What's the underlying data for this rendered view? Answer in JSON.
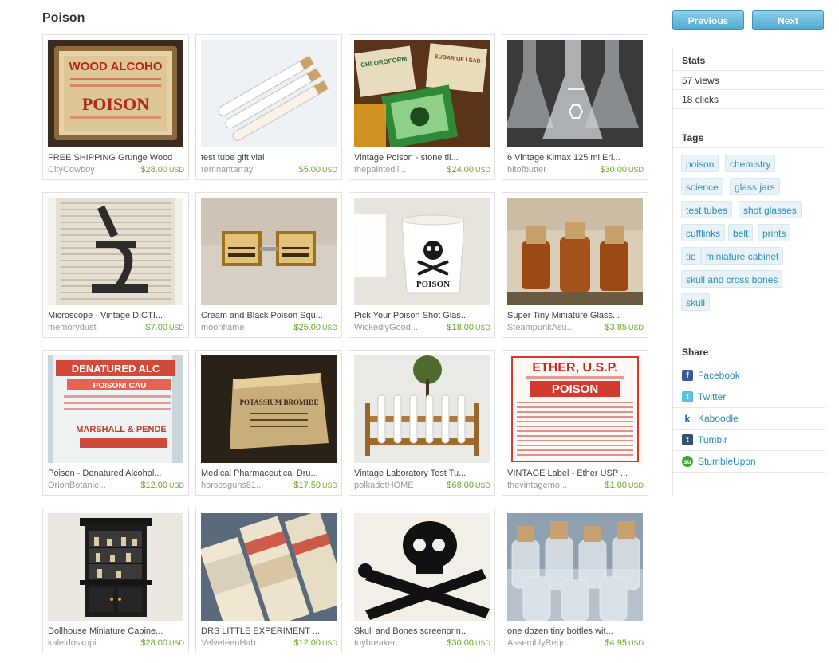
{
  "page": {
    "title": "Poison"
  },
  "nav": {
    "previous_label": "Previous",
    "next_label": "Next"
  },
  "items": [
    {
      "title": "FREE SHIPPING Grunge Wood",
      "shop": "CityCowboy",
      "price": "$28.00",
      "currency": "USD"
    },
    {
      "title": "test tube gift vial",
      "shop": "remnantarray",
      "price": "$5.00",
      "currency": "USD"
    },
    {
      "title": "Vintage Poison - stone til...",
      "shop": "thepaintedli...",
      "price": "$24.00",
      "currency": "USD"
    },
    {
      "title": "6 Vintage Kimax 125 ml Erl...",
      "shop": "bitofbutter",
      "price": "$30.00",
      "currency": "USD"
    },
    {
      "title": "Microscope - Vintage DICTI...",
      "shop": "memorydust",
      "price": "$7.00",
      "currency": "USD"
    },
    {
      "title": "Cream and Black Poison Squ...",
      "shop": "moonflame",
      "price": "$25.00",
      "currency": "USD"
    },
    {
      "title": "Pick Your Poison Shot Glas...",
      "shop": "WickedlyGood...",
      "price": "$18.00",
      "currency": "USD"
    },
    {
      "title": "Super Tiny Miniature Glass...",
      "shop": "SteampunkAsu...",
      "price": "$3.85",
      "currency": "USD"
    },
    {
      "title": "Poison - Denatured Alcohol...",
      "shop": "OrionBotanic...",
      "price": "$12.00",
      "currency": "USD"
    },
    {
      "title": "Medical Pharmaceutical Dru...",
      "shop": "horsesguns81...",
      "price": "$17.50",
      "currency": "USD"
    },
    {
      "title": "Vintage Laboratory Test Tu...",
      "shop": "polkadotHOME",
      "price": "$68.00",
      "currency": "USD"
    },
    {
      "title": "VINTAGE Label - Ether USP ...",
      "shop": "thevintagemo...",
      "price": "$1.00",
      "currency": "USD"
    },
    {
      "title": "Dollhouse Miniature Cabine...",
      "shop": "kaleidoskopi...",
      "price": "$28.00",
      "currency": "USD"
    },
    {
      "title": "DRS LITTLE EXPERIMENT ...",
      "shop": "VelveteenHab...",
      "price": "$12.00",
      "currency": "USD"
    },
    {
      "title": "Skull and Bones screenprin...",
      "shop": "toybreaker",
      "price": "$30.00",
      "currency": "USD"
    },
    {
      "title": "one dozen tiny bottles wit...",
      "shop": "AssemblyRequ...",
      "price": "$4.95",
      "currency": "USD"
    }
  ],
  "images": {
    "wood_label_text": "WOOD ALCOHO",
    "wood_label_poison": "POISON",
    "chloroform_label": "CHLOROFORM",
    "lead_label": "SUGAR OF LEAD",
    "shot_glass_text": "POISON",
    "denatured_label": "DENATURED ALC",
    "denatured_poison": "POISON! CAU",
    "denatured_maker": "MARSHALL & PENDE",
    "potassium_label": "POTASSIUM BROMIDE",
    "ether_title": "ETHER, U.S.P.",
    "ether_poison": "POISON"
  },
  "sidebar": {
    "stats_heading": "Stats",
    "views": "57 views",
    "clicks": "18 clicks",
    "tags_heading": "Tags",
    "tags": [
      "poison",
      "chemistry",
      "science",
      "glass jars",
      "test tubes",
      "shot glasses",
      "cufflinks",
      "belt",
      "prints",
      "tie",
      "miniature cabinet",
      "skull and cross bones",
      "skull"
    ],
    "share_heading": "Share",
    "share": [
      {
        "label": "Facebook",
        "icon": "facebook-icon",
        "color": "#3b5998",
        "glyph": "f"
      },
      {
        "label": "Twitter",
        "icon": "twitter-icon",
        "color": "#5bc0de",
        "glyph": "t"
      },
      {
        "label": "Kaboodle",
        "icon": "kaboodle-icon",
        "color": "#2a6ab8",
        "glyph": "k"
      },
      {
        "label": "Tumblr",
        "icon": "tumblr-icon",
        "color": "#34526f",
        "glyph": "t"
      },
      {
        "label": "StumbleUpon",
        "icon": "stumbleupon-icon",
        "color": "#38a82f",
        "glyph": "su"
      }
    ]
  }
}
